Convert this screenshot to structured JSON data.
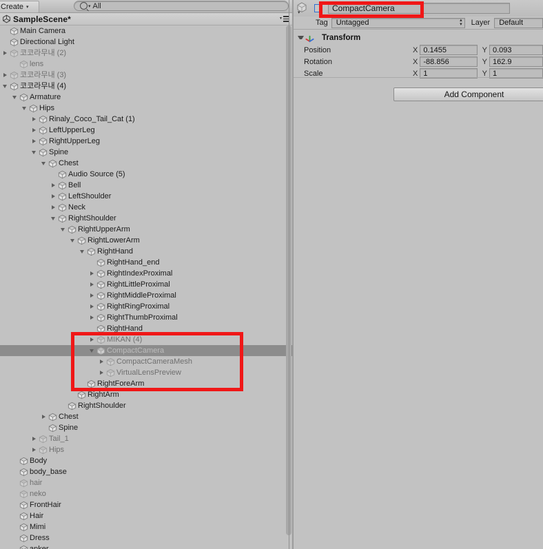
{
  "hierarchy": {
    "toolbar": {
      "create_label": "Create",
      "create_caret": "▾",
      "search_value": "All",
      "search_caret": "▾"
    },
    "scene": {
      "title": "SampleScene*",
      "menu_caret": "▾"
    },
    "rows": [
      {
        "label": "Main Camera",
        "indent": 1,
        "twisty": "none",
        "dim": false,
        "selected": false
      },
      {
        "label": "Directional Light",
        "indent": 1,
        "twisty": "none",
        "dim": false,
        "selected": false
      },
      {
        "label": "코코라무내 (2)",
        "indent": 1,
        "twisty": "right",
        "dim": true,
        "selected": false
      },
      {
        "label": "lens",
        "indent": 2,
        "twisty": "none",
        "dim": true,
        "selected": false
      },
      {
        "label": "코코라무내 (3)",
        "indent": 1,
        "twisty": "right",
        "dim": true,
        "selected": false
      },
      {
        "label": "코코라무내 (4)",
        "indent": 1,
        "twisty": "down",
        "dim": false,
        "selected": false
      },
      {
        "label": "Armature",
        "indent": 2,
        "twisty": "down",
        "dim": false,
        "selected": false
      },
      {
        "label": "Hips",
        "indent": 3,
        "twisty": "down",
        "dim": false,
        "selected": false
      },
      {
        "label": "Rinaly_Coco_Tail_Cat (1)",
        "indent": 4,
        "twisty": "right",
        "dim": false,
        "selected": false
      },
      {
        "label": "LeftUpperLeg",
        "indent": 4,
        "twisty": "right",
        "dim": false,
        "selected": false
      },
      {
        "label": "RightUpperLeg",
        "indent": 4,
        "twisty": "right",
        "dim": false,
        "selected": false
      },
      {
        "label": "Spine",
        "indent": 4,
        "twisty": "down",
        "dim": false,
        "selected": false
      },
      {
        "label": "Chest",
        "indent": 5,
        "twisty": "down",
        "dim": false,
        "selected": false
      },
      {
        "label": "Audio Source (5)",
        "indent": 6,
        "twisty": "none",
        "dim": false,
        "selected": false
      },
      {
        "label": "Bell",
        "indent": 6,
        "twisty": "right",
        "dim": false,
        "selected": false
      },
      {
        "label": "LeftShoulder",
        "indent": 6,
        "twisty": "right",
        "dim": false,
        "selected": false
      },
      {
        "label": "Neck",
        "indent": 6,
        "twisty": "right",
        "dim": false,
        "selected": false
      },
      {
        "label": "RightShoulder",
        "indent": 6,
        "twisty": "down",
        "dim": false,
        "selected": false
      },
      {
        "label": "RightUpperArm",
        "indent": 7,
        "twisty": "down",
        "dim": false,
        "selected": false
      },
      {
        "label": "RightLowerArm",
        "indent": 8,
        "twisty": "down",
        "dim": false,
        "selected": false
      },
      {
        "label": "RightHand",
        "indent": 9,
        "twisty": "down",
        "dim": false,
        "selected": false
      },
      {
        "label": "RightHand_end",
        "indent": 10,
        "twisty": "none",
        "dim": false,
        "selected": false
      },
      {
        "label": "RightIndexProximal",
        "indent": 10,
        "twisty": "right",
        "dim": false,
        "selected": false
      },
      {
        "label": "RightLittleProximal",
        "indent": 10,
        "twisty": "right",
        "dim": false,
        "selected": false
      },
      {
        "label": "RightMiddleProximal",
        "indent": 10,
        "twisty": "right",
        "dim": false,
        "selected": false
      },
      {
        "label": "RightRingProximal",
        "indent": 10,
        "twisty": "right",
        "dim": false,
        "selected": false
      },
      {
        "label": "RightThumbProximal",
        "indent": 10,
        "twisty": "right",
        "dim": false,
        "selected": false
      },
      {
        "label": "RightHand",
        "indent": 10,
        "twisty": "none",
        "dim": false,
        "selected": false
      },
      {
        "label": "MIKAN (4)",
        "indent": 10,
        "twisty": "right",
        "dim": true,
        "selected": false
      },
      {
        "label": "CompactCamera",
        "indent": 10,
        "twisty": "down",
        "dim": true,
        "selected": true
      },
      {
        "label": "CompactCameraMesh",
        "indent": 11,
        "twisty": "right",
        "dim": true,
        "selected": false
      },
      {
        "label": "VirtualLensPreview",
        "indent": 11,
        "twisty": "right",
        "dim": true,
        "selected": false
      },
      {
        "label": "RightForeArm",
        "indent": 9,
        "twisty": "none",
        "dim": false,
        "selected": false
      },
      {
        "label": "RightArm",
        "indent": 8,
        "twisty": "none",
        "dim": false,
        "selected": false
      },
      {
        "label": "RightShoulder",
        "indent": 7,
        "twisty": "none",
        "dim": false,
        "selected": false
      },
      {
        "label": "Chest",
        "indent": 5,
        "twisty": "right",
        "dim": false,
        "selected": false
      },
      {
        "label": "Spine",
        "indent": 5,
        "twisty": "none",
        "dim": false,
        "selected": false
      },
      {
        "label": "Tail_1",
        "indent": 4,
        "twisty": "right",
        "dim": true,
        "selected": false
      },
      {
        "label": "Hips",
        "indent": 4,
        "twisty": "right",
        "dim": true,
        "selected": false
      },
      {
        "label": "Body",
        "indent": 2,
        "twisty": "none",
        "dim": false,
        "selected": false
      },
      {
        "label": "body_base",
        "indent": 2,
        "twisty": "none",
        "dim": false,
        "selected": false
      },
      {
        "label": "hair",
        "indent": 2,
        "twisty": "none",
        "dim": true,
        "selected": false
      },
      {
        "label": "neko",
        "indent": 2,
        "twisty": "none",
        "dim": true,
        "selected": false
      },
      {
        "label": "FrontHair",
        "indent": 2,
        "twisty": "none",
        "dim": false,
        "selected": false
      },
      {
        "label": "Hair",
        "indent": 2,
        "twisty": "none",
        "dim": false,
        "selected": false
      },
      {
        "label": "Mimi",
        "indent": 2,
        "twisty": "none",
        "dim": false,
        "selected": false
      },
      {
        "label": "Dress",
        "indent": 2,
        "twisty": "none",
        "dim": false,
        "selected": false
      },
      {
        "label": "anker",
        "indent": 2,
        "twisty": "none",
        "dim": false,
        "selected": false
      }
    ]
  },
  "inspector": {
    "object_name": "CompactCamera",
    "active_checked": false,
    "tag_label": "Tag",
    "tag_value": "Untagged",
    "layer_label": "Layer",
    "layer_value": "Default",
    "dropdown_arrows": "⬍",
    "transform": {
      "title": "Transform",
      "rows": [
        {
          "label": "Position",
          "x_axis": "X",
          "x": "0.1455",
          "y_axis": "Y",
          "y": "0.093"
        },
        {
          "label": "Rotation",
          "x_axis": "X",
          "x": "-88.856",
          "y_axis": "Y",
          "y": "162.9"
        },
        {
          "label": "Scale",
          "x_axis": "X",
          "x": "1",
          "y_axis": "Y",
          "y": "1"
        }
      ]
    },
    "add_component_label": "Add Component"
  },
  "annotations": {
    "accent_color": "#f01717",
    "tree_box": "compactcamera-subtree-highlight",
    "name_box": "object-name-highlight"
  }
}
